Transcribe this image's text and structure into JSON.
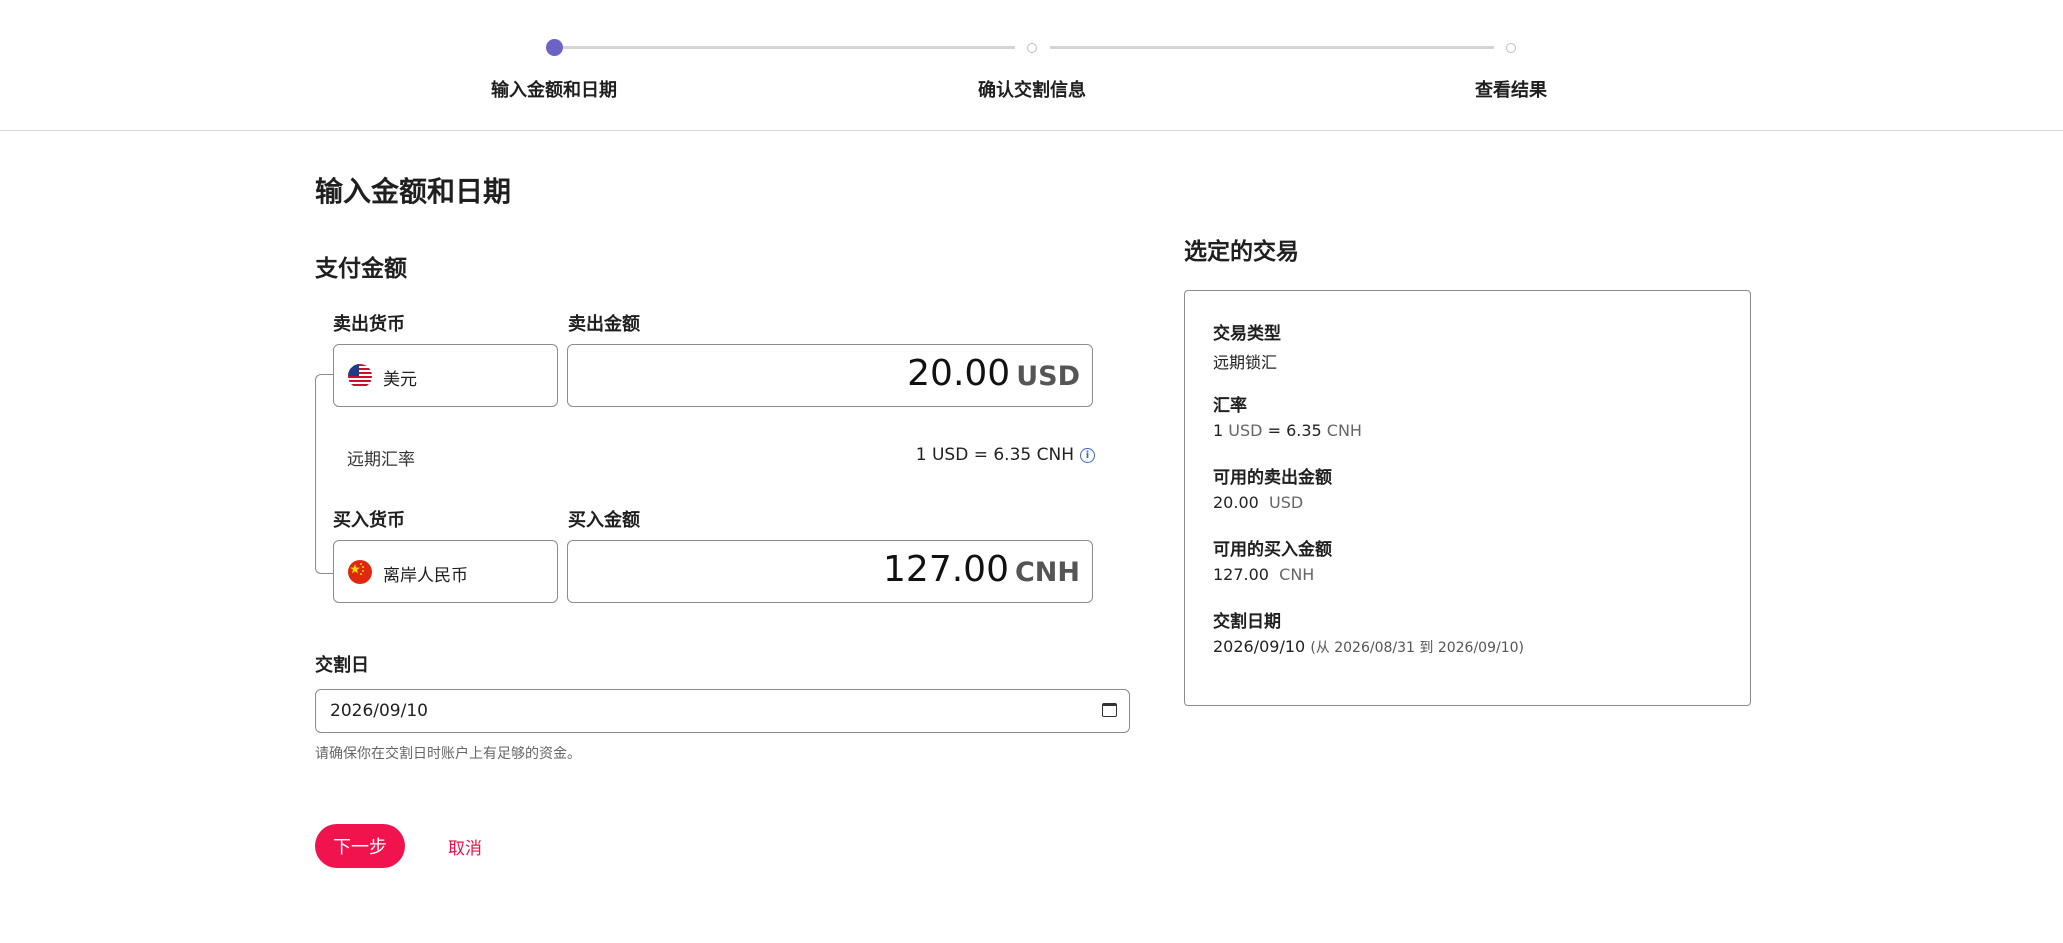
{
  "stepper": {
    "steps": [
      {
        "label": "输入金额和日期"
      },
      {
        "label": "确认交割信息"
      },
      {
        "label": "查看结果"
      }
    ],
    "active_color": "#6b63c6"
  },
  "main": {
    "title": "输入金额和日期",
    "payment_title": "支付金额",
    "sell_currency_label": "卖出货币",
    "sell_amount_label": "卖出金额",
    "sell_currency": "美元",
    "sell_amount": "20.00",
    "sell_ccy": "USD",
    "rate_label": "远期汇率",
    "rate_value": "1 USD = 6.35 CNH",
    "buy_currency_label": "买入货币",
    "buy_amount_label": "买入金额",
    "buy_currency": "离岸人民币",
    "buy_amount": "127.00",
    "buy_ccy": "CNH",
    "settle_label": "交割日",
    "settle_date": "2026/09/10",
    "hint": "请确保你在交割日时账户上有足够的资金。",
    "next_label": "下一步",
    "cancel_label": "取消",
    "accent_color": "#f0134d"
  },
  "side": {
    "title": "选定的交易",
    "type_label": "交易类型",
    "type_value": "远期锁汇",
    "rate_label": "汇率",
    "rate_1": "1",
    "rate_usd": "USD",
    "rate_eq": "=",
    "rate_num": "6.35",
    "rate_cnh": "CNH",
    "sell_label": "可用的卖出金额",
    "sell_value": "20.00",
    "sell_ccy": "USD",
    "buy_label": "可用的买入金额",
    "buy_value": "127.00",
    "buy_ccy": "CNH",
    "date_label": "交割日期",
    "date_value": "2026/09/10",
    "date_range": "(从 2026/08/31 到 2026/09/10)"
  }
}
